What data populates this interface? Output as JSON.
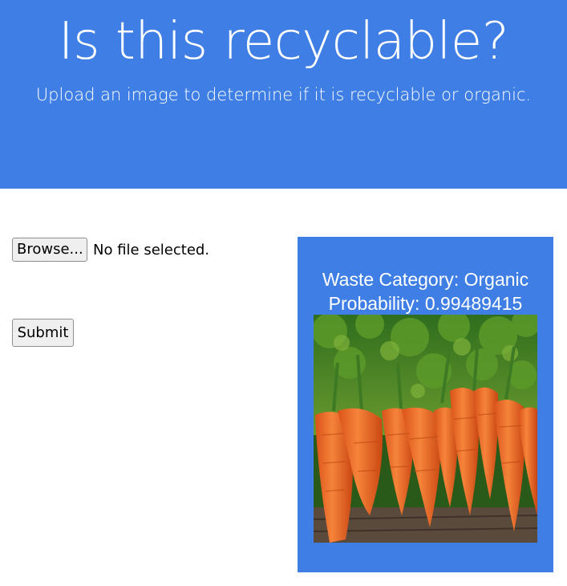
{
  "header": {
    "title": "Is this recyclable?",
    "subtitle": "Upload an image to determine if it is recyclable or organic."
  },
  "form": {
    "browse_label": "Browse...",
    "file_status": "No file selected.",
    "submit_label": "Submit"
  },
  "result": {
    "category_text": "Waste Category: Organic",
    "probability_text": "Probability: 0.99489415",
    "image_subject": "carrots"
  },
  "colors": {
    "accent_blue": "#3f7fe5",
    "background": "#ffffff",
    "button_bg": "#efefef"
  }
}
